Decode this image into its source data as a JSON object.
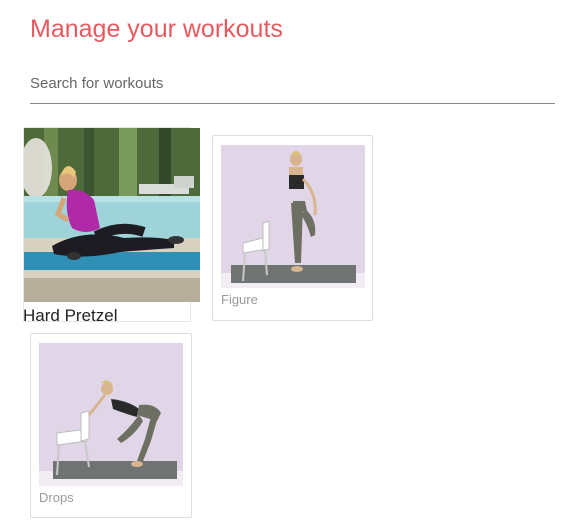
{
  "header": {
    "title": "Manage your workouts"
  },
  "search": {
    "placeholder": "Search for workouts"
  },
  "workouts": [
    {
      "label": "Hard Pretzel"
    },
    {
      "label": "Figure"
    },
    {
      "label": "Drops"
    }
  ],
  "colors": {
    "accent": "#e8595f",
    "thumb_background": "#e1d6e8",
    "mat": "#6f7472"
  }
}
